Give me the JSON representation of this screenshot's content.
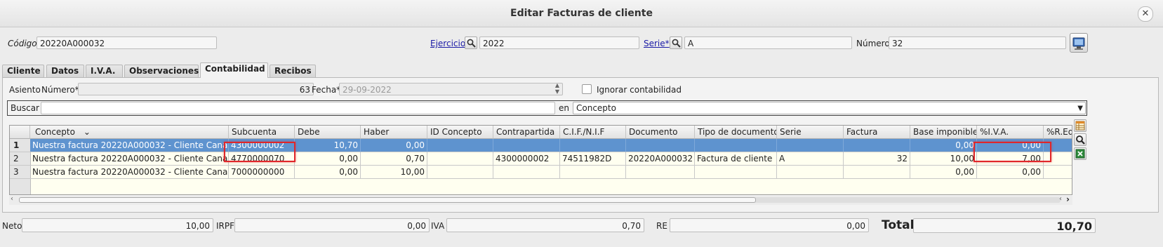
{
  "window": {
    "title": "Editar Facturas de cliente",
    "close_glyph": "✕"
  },
  "header": {
    "codigo_label": "Código",
    "codigo_value": "20220A000032",
    "ejercicio_label": "Ejercicio",
    "ejercicio_value": "2022",
    "serie_label": "Serie*",
    "serie_value": "A",
    "numero_label": "Número",
    "numero_value": "32"
  },
  "tabs": [
    {
      "label": "Cliente"
    },
    {
      "label": "Datos"
    },
    {
      "label": "I.V.A."
    },
    {
      "label": "Observaciones"
    },
    {
      "label": "Contabilidad",
      "active": true
    },
    {
      "label": "Recibos"
    }
  ],
  "asiento": {
    "label": "Asiento",
    "numero_label": "Número*",
    "numero_value": "63",
    "fecha_label": "Fecha*",
    "fecha_value": "29-09-2022",
    "ignorar_label": "Ignorar contabilidad"
  },
  "search": {
    "label": "Buscar",
    "value": "",
    "en_label": "en",
    "field_value": "Concepto"
  },
  "table": {
    "columns": [
      "Concepto",
      "Subcuenta",
      "Debe",
      "Haber",
      "ID Concepto",
      "Contrapartida",
      "C.I.F./N.I.F",
      "Documento",
      "Tipo de documento",
      "Serie",
      "Factura",
      "Base imponible",
      "%I.V.A.",
      "%R.Eq"
    ],
    "sort_glyph": "⌄",
    "rows": [
      {
        "num": "1",
        "cells": [
          "Nuestra factura 20220A000032 - Cliente Canario",
          "4300000002",
          "10,70",
          "0,00",
          "",
          "",
          "",
          "",
          "",
          "",
          "",
          "0,00",
          "0,00",
          ""
        ]
      },
      {
        "num": "2",
        "cells": [
          "Nuestra factura 20220A000032 - Cliente Canario",
          "4770000070",
          "0,00",
          "0,70",
          "",
          "4300000002",
          "74511982D",
          "20220A000032",
          "Factura de cliente",
          "A",
          "32",
          "10,00",
          "7,00",
          ""
        ]
      },
      {
        "num": "3",
        "cells": [
          "Nuestra factura 20220A000032 - Cliente Canario",
          "7000000000",
          "0,00",
          "10,00",
          "",
          "",
          "",
          "",
          "",
          "",
          "",
          "0,00",
          "0,00",
          ""
        ]
      }
    ]
  },
  "totals": {
    "neto_label": "Neto",
    "neto_value": "10,00",
    "irpf_label": "IRPF",
    "irpf_value": "0,00",
    "iva_label": "IVA",
    "iva_value": "0,70",
    "re_label": "RE",
    "re_value": "0,00",
    "total_label": "Total",
    "total_value": "10,70"
  },
  "icons": {
    "search": "magnifier-icon",
    "print": "print-config-icon",
    "table_config": "table-config-icon",
    "export": "excel-export-icon"
  }
}
